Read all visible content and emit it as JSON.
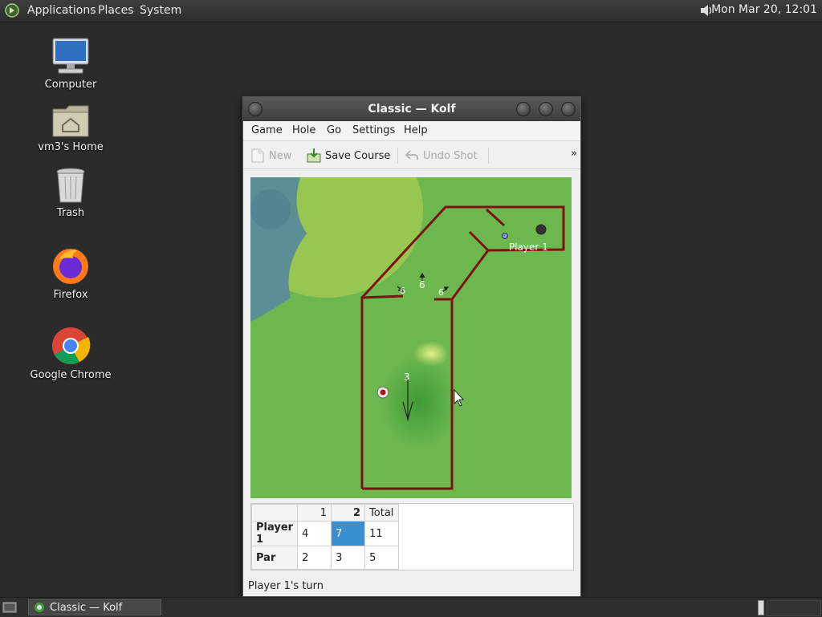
{
  "top_panel": {
    "menus": [
      "Applications",
      "Places",
      "System"
    ],
    "clock": "Mon Mar 20, 12:01"
  },
  "desktop_icons": [
    {
      "label": "Computer",
      "icon": "computer-icon"
    },
    {
      "label": "vm3's Home",
      "icon": "home-folder-icon"
    },
    {
      "label": "Trash",
      "icon": "trash-icon"
    },
    {
      "label": "Firefox",
      "icon": "firefox-icon"
    },
    {
      "label": "Google Chrome",
      "icon": "chrome-icon"
    }
  ],
  "window": {
    "title": "Classic  — Kolf",
    "menu": [
      "Game",
      "Hole",
      "Go",
      "Settings",
      "Help"
    ],
    "toolbar": {
      "new_label": "New",
      "save_label": "Save Course",
      "undo_label": "Undo Shot",
      "overflow": "»"
    },
    "course": {
      "player_label": "Player 1",
      "labels": [
        "6",
        "6",
        "6",
        "3"
      ],
      "colors": {
        "grass": "#6db84e",
        "wall": "#7a1414"
      }
    },
    "scoreboard": {
      "headers": [
        "",
        "1",
        "2",
        "Total"
      ],
      "rows": [
        {
          "name": "Player 1",
          "cells": [
            "4",
            "7",
            "11"
          ]
        },
        {
          "name": "Par",
          "cells": [
            "2",
            "3",
            "5"
          ]
        }
      ]
    },
    "status": "Player 1's turn"
  },
  "taskbar": {
    "task_label": "Classic  — Kolf"
  }
}
